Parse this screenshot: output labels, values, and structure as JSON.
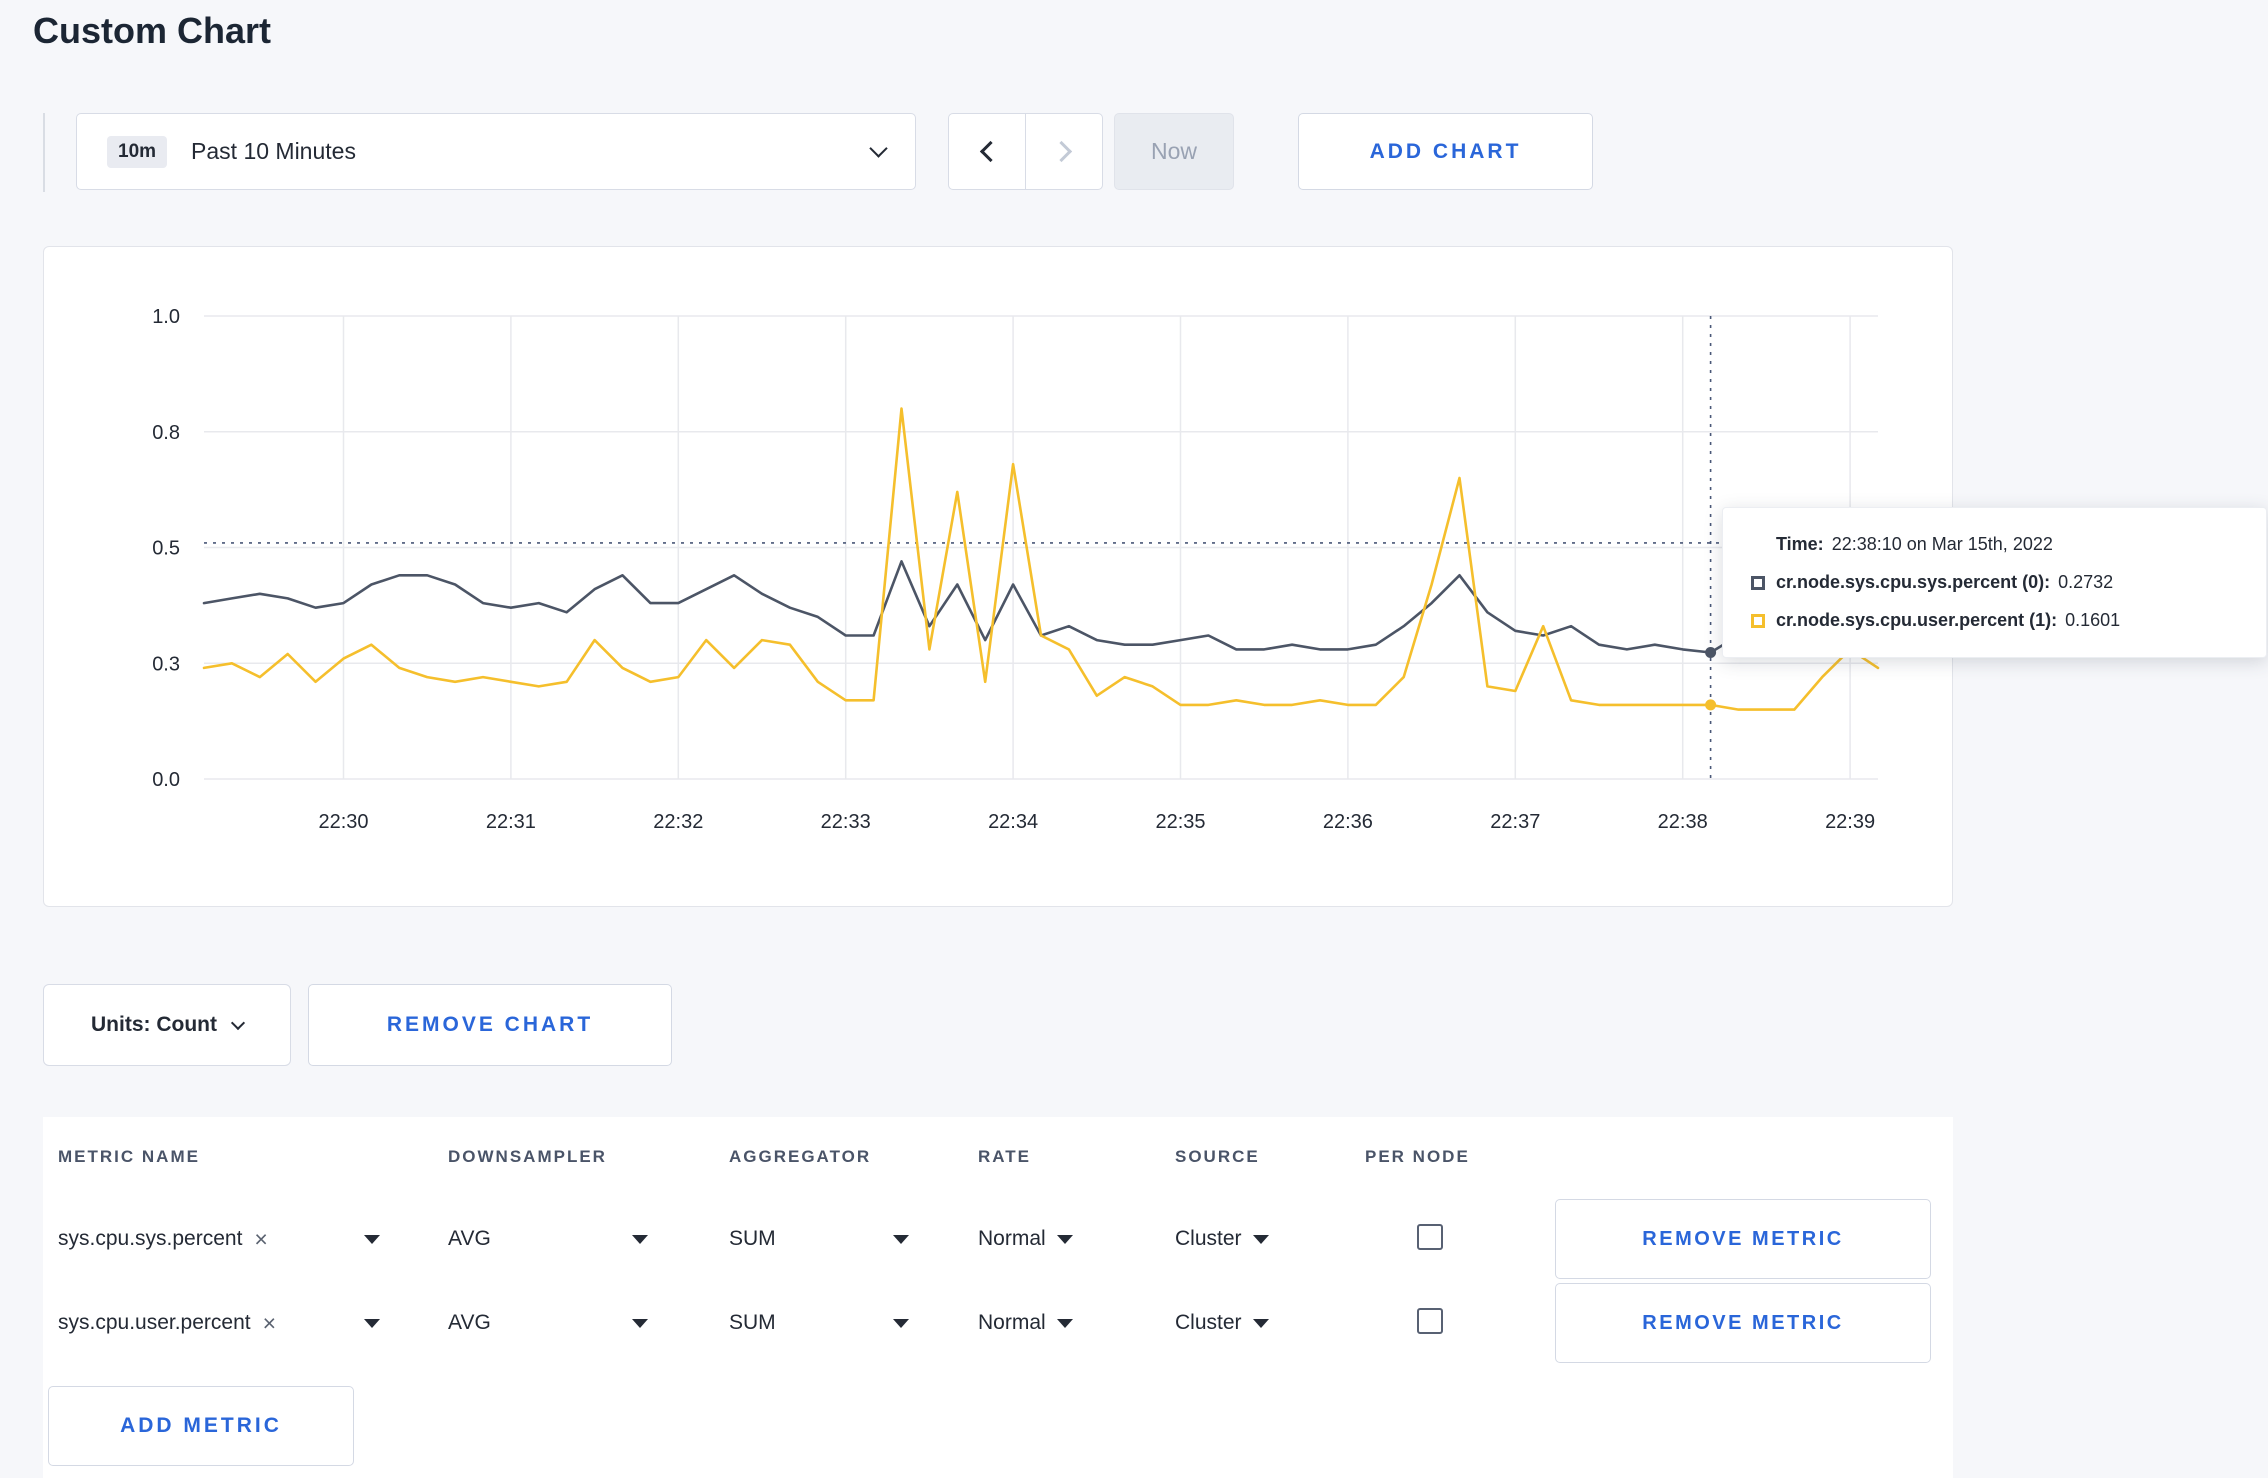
{
  "title": "Custom Chart",
  "colors": {
    "accent_blue": "#2a66d9",
    "series_sys": "#4c5566",
    "series_user": "#f5bf2c"
  },
  "icons": {
    "dropdown_chevron": "chevron-down",
    "prev": "chevron-left",
    "next": "chevron-right",
    "select_caret": "triangle-down",
    "remove_tag": "×"
  },
  "controls": {
    "time_badge": "10m",
    "time_label": "Past 10 Minutes",
    "now_label": "Now",
    "add_chart_label": "ADD CHART"
  },
  "chart_data": {
    "type": "line",
    "title": "",
    "xlabel": "",
    "ylabel": "",
    "ylim": [
      0,
      1
    ],
    "grid": true,
    "x_ticks": [
      "22:30",
      "22:31",
      "22:32",
      "22:33",
      "22:34",
      "22:35",
      "22:36",
      "22:37",
      "22:38",
      "22:39"
    ],
    "first_tick_index": 5,
    "tick_step": 6,
    "x_interval_seconds": 10,
    "x_start_time": "22:29:10",
    "y_ticks": [
      {
        "value": 1.0,
        "label": "1.0"
      },
      {
        "value": 0.75,
        "label": "0.8"
      },
      {
        "value": 0.5,
        "label": "0.5"
      },
      {
        "value": 0.25,
        "label": "0.3"
      },
      {
        "value": 0.0,
        "label": "0.0"
      }
    ],
    "crosshair": {
      "x_index": 54,
      "y_value": 0.51,
      "time": "22:38:10"
    },
    "series": [
      {
        "name": "cr.node.sys.cpu.sys.percent",
        "color": "#4c5566",
        "values": [
          0.38,
          0.39,
          0.4,
          0.39,
          0.37,
          0.38,
          0.42,
          0.44,
          0.44,
          0.42,
          0.38,
          0.37,
          0.38,
          0.36,
          0.41,
          0.44,
          0.38,
          0.38,
          0.41,
          0.44,
          0.4,
          0.37,
          0.35,
          0.31,
          0.31,
          0.47,
          0.33,
          0.42,
          0.3,
          0.42,
          0.31,
          0.33,
          0.3,
          0.29,
          0.29,
          0.3,
          0.31,
          0.28,
          0.28,
          0.29,
          0.28,
          0.28,
          0.29,
          0.33,
          0.38,
          0.44,
          0.36,
          0.32,
          0.31,
          0.33,
          0.29,
          0.28,
          0.29,
          0.28,
          0.2732,
          0.31,
          0.32,
          0.3,
          0.3,
          0.31,
          0.3
        ]
      },
      {
        "name": "cr.node.sys.cpu.user.percent",
        "color": "#f5bf2c",
        "values": [
          0.24,
          0.25,
          0.22,
          0.27,
          0.21,
          0.26,
          0.29,
          0.24,
          0.22,
          0.21,
          0.22,
          0.21,
          0.2,
          0.21,
          0.3,
          0.24,
          0.21,
          0.22,
          0.3,
          0.24,
          0.3,
          0.29,
          0.21,
          0.17,
          0.17,
          0.8,
          0.28,
          0.62,
          0.21,
          0.68,
          0.31,
          0.28,
          0.18,
          0.22,
          0.2,
          0.16,
          0.16,
          0.17,
          0.16,
          0.16,
          0.17,
          0.16,
          0.16,
          0.22,
          0.42,
          0.65,
          0.2,
          0.19,
          0.33,
          0.17,
          0.16,
          0.16,
          0.16,
          0.16,
          0.1601,
          0.15,
          0.15,
          0.15,
          0.22,
          0.28,
          0.24
        ]
      }
    ]
  },
  "tooltip": {
    "time_label": "Time:",
    "time_value": "22:38:10 on Mar 15th, 2022",
    "rows": [
      {
        "label": "cr.node.sys.cpu.sys.percent (0):",
        "value": "0.2732",
        "color": "#4c5566"
      },
      {
        "label": "cr.node.sys.cpu.user.percent (1):",
        "value": "0.1601",
        "color": "#f5bf2c"
      }
    ]
  },
  "under_chart": {
    "units_label": "Units: Count",
    "remove_chart_label": "REMOVE CHART"
  },
  "table": {
    "headers": [
      "METRIC NAME",
      "DOWNSAMPLER",
      "AGGREGATOR",
      "RATE",
      "SOURCE",
      "PER NODE"
    ],
    "rows": [
      {
        "metric": "sys.cpu.sys.percent",
        "downsampler": "AVG",
        "aggregator": "SUM",
        "rate": "Normal",
        "source": "Cluster",
        "per_node_checked": false,
        "remove_label": "REMOVE METRIC"
      },
      {
        "metric": "sys.cpu.user.percent",
        "downsampler": "AVG",
        "aggregator": "SUM",
        "rate": "Normal",
        "source": "Cluster",
        "per_node_checked": false,
        "remove_label": "REMOVE METRIC"
      }
    ],
    "add_metric_label": "ADD METRIC"
  }
}
